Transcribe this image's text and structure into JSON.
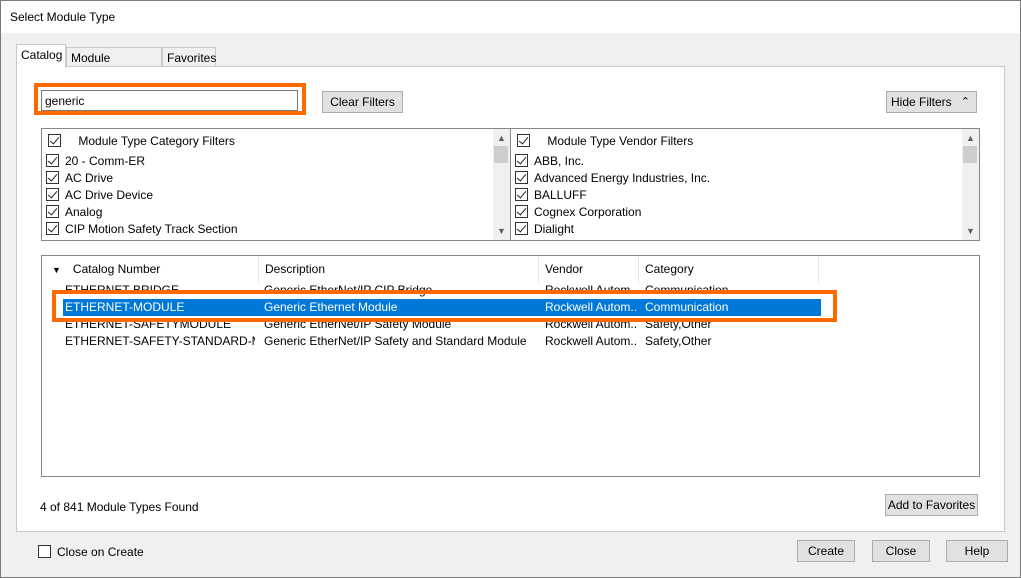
{
  "window": {
    "title": "Select Module Type"
  },
  "tabs": [
    {
      "label": "Catalog",
      "active": true
    },
    {
      "label": "Module Discovery",
      "active": false
    },
    {
      "label": "Favorites",
      "active": false
    }
  ],
  "search": {
    "value": "generic",
    "placeholder": ""
  },
  "buttons": {
    "clear_filters": "Clear Filters",
    "hide_filters": "Hide Filters",
    "add_to_favorites": "Add to Favorites",
    "create": "Create",
    "close": "Close",
    "help": "Help"
  },
  "category_filters": {
    "header": "Module Type Category Filters",
    "items": [
      "20 - Comm-ER",
      "AC Drive",
      "AC Drive Device",
      "Analog",
      "CIP Motion Safety Track Section"
    ]
  },
  "vendor_filters": {
    "header": "Module Type Vendor Filters",
    "items": [
      "ABB, Inc.",
      "Advanced Energy Industries, Inc.",
      "BALLUFF",
      "Cognex Corporation",
      "Dialight"
    ]
  },
  "grid": {
    "columns": [
      "Catalog Number",
      "Description",
      "Vendor",
      "Category"
    ],
    "rows": [
      {
        "catalog": "ETHERNET-BRIDGE",
        "description": "Generic EtherNet/IP CIP Bridge",
        "vendor": "Rockwell Autom...",
        "category": "Communication",
        "selected": false
      },
      {
        "catalog": "ETHERNET-MODULE",
        "description": "Generic Ethernet Module",
        "vendor": "Rockwell Autom...",
        "category": "Communication",
        "selected": true
      },
      {
        "catalog": "ETHERNET-SAFETYMODULE",
        "description": "Generic EtherNet/IP Safety Module",
        "vendor": "Rockwell Autom...",
        "category": "Safety,Other",
        "selected": false
      },
      {
        "catalog": "ETHERNET-SAFETY-STANDARD-M...",
        "description": "Generic EtherNet/IP Safety and Standard Module",
        "vendor": "Rockwell Autom...",
        "category": "Safety,Other",
        "selected": false
      }
    ]
  },
  "status": {
    "found_text": "4 of 841 Module Types Found"
  },
  "close_on_create": {
    "label": "Close on Create",
    "checked": false
  },
  "colors": {
    "highlight": "#ff6a00",
    "selection": "#0078d7"
  }
}
